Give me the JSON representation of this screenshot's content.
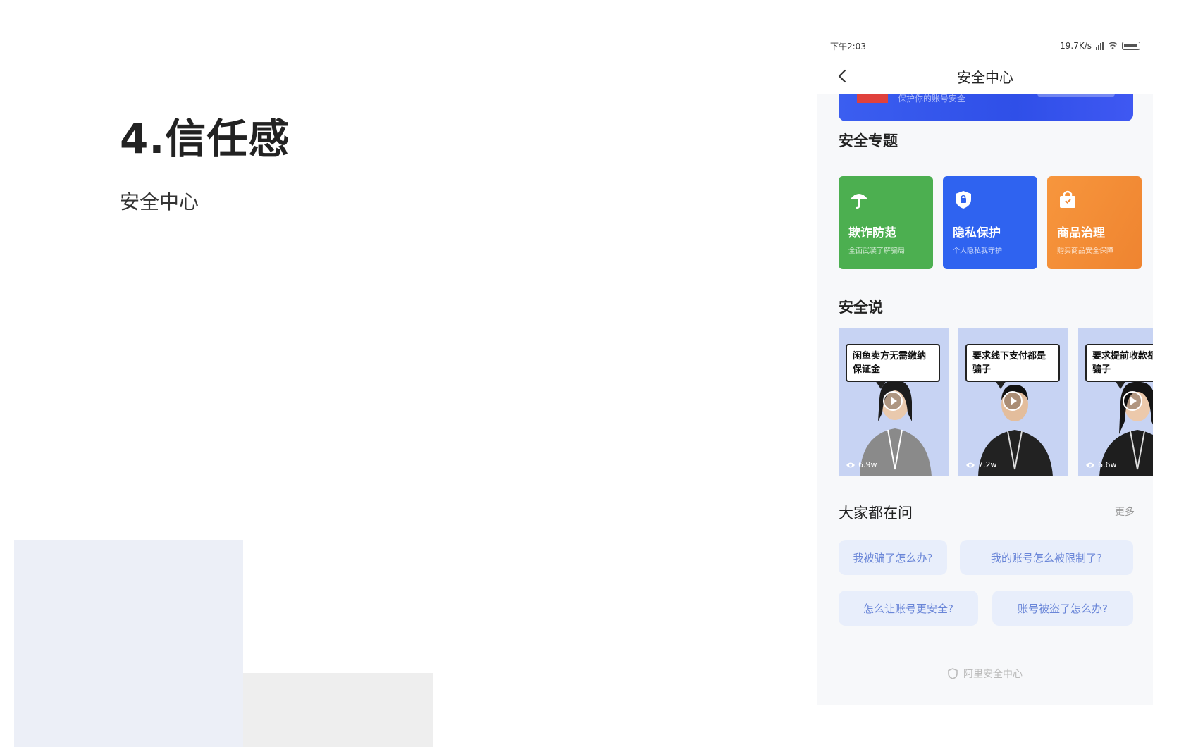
{
  "slide": {
    "title": "4.信任感",
    "subtitle": "安全中心"
  },
  "phone": {
    "status_bar": {
      "time": "下午2:03",
      "network_speed": "19.7K/s"
    },
    "nav": {
      "title": "安全中心",
      "back_icon": "chevron-left-icon"
    },
    "banner": {
      "text": "保护你的账号安全"
    },
    "sections": {
      "topics_title": "安全专题",
      "talks_title": "安全说",
      "faq_title": "大家都在问",
      "faq_more": "更多"
    },
    "topics": [
      {
        "name": "欺诈防范",
        "desc": "全面武装了解骗局",
        "color": "#4caf50",
        "icon": "umbrella-icon"
      },
      {
        "name": "隐私保护",
        "desc": "个人隐私我守护",
        "color": "#2f63f0",
        "icon": "shield-icon"
      },
      {
        "name": "商品治理",
        "desc": "购买商品安全保障",
        "color": "#f38a34",
        "icon": "bag-icon"
      }
    ],
    "videos": [
      {
        "caption": "闲鱼卖方无需缴纳保证金",
        "views": "6.9w",
        "shirt": "#8a8a8a"
      },
      {
        "caption": "要求线下支付都是骗子",
        "views": "7.2w",
        "shirt": "#222222"
      },
      {
        "caption": "要求提前收款都是骗子",
        "views": "6.6w",
        "shirt": "#1e1e1e"
      }
    ],
    "faq": [
      "我被骗了怎么办?",
      "我的账号怎么被限制了?",
      "怎么让账号更安全?",
      "账号被盗了怎么办?"
    ],
    "footer": "阿里安全中心"
  }
}
